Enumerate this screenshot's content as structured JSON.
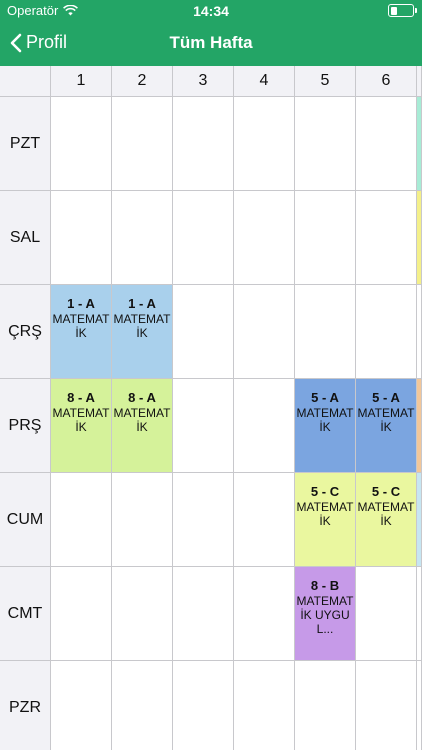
{
  "status_bar": {
    "carrier": "Operatör",
    "time": "14:34"
  },
  "nav": {
    "back_label": "Profil",
    "title": "Tüm Hafta"
  },
  "periods": [
    "1",
    "2",
    "3",
    "4",
    "5",
    "6"
  ],
  "days": [
    "PZT",
    "SAL",
    "ÇRŞ",
    "PRŞ",
    "CUM",
    "CMT",
    "PZR"
  ],
  "lessons": [
    {
      "day": 2,
      "period": 0,
      "class": "1 - A",
      "subject": "MATEMATİK",
      "color": "#a9d0ec"
    },
    {
      "day": 2,
      "period": 1,
      "class": "1 - A",
      "subject": "MATEMATİK",
      "color": "#a9d0ec"
    },
    {
      "day": 3,
      "period": 0,
      "class": "8 - A",
      "subject": "MATEMATİK",
      "color": "#d5f29a"
    },
    {
      "day": 3,
      "period": 1,
      "class": "8 - A",
      "subject": "MATEMATİK",
      "color": "#d5f29a"
    },
    {
      "day": 3,
      "period": 4,
      "class": "5 - A",
      "subject": "MATEMATİK",
      "color": "#7ba5e0"
    },
    {
      "day": 3,
      "period": 5,
      "class": "5 - A",
      "subject": "MATEMATİK",
      "color": "#7ba5e0"
    },
    {
      "day": 4,
      "period": 4,
      "class": "5 - C",
      "subject": "MATEMATİK",
      "color": "#eaf79f"
    },
    {
      "day": 4,
      "period": 5,
      "class": "5 - C",
      "subject": "MATEMATİK",
      "color": "#eaf79f"
    },
    {
      "day": 5,
      "period": 4,
      "class": "8 - B",
      "subject": "MATEMATİK UYGUL...",
      "color": "#c69ae8"
    }
  ],
  "edge_colors": [
    "#a8ecd6",
    "#f4f08a",
    "#ffffff",
    "#f2c79a",
    "#c7e6f2",
    "#ffffff",
    "#ffffff"
  ],
  "colors": {
    "header_bar": "#23a566",
    "grid_line": "#c8c8cc",
    "header_cell": "#f2f2f6"
  }
}
